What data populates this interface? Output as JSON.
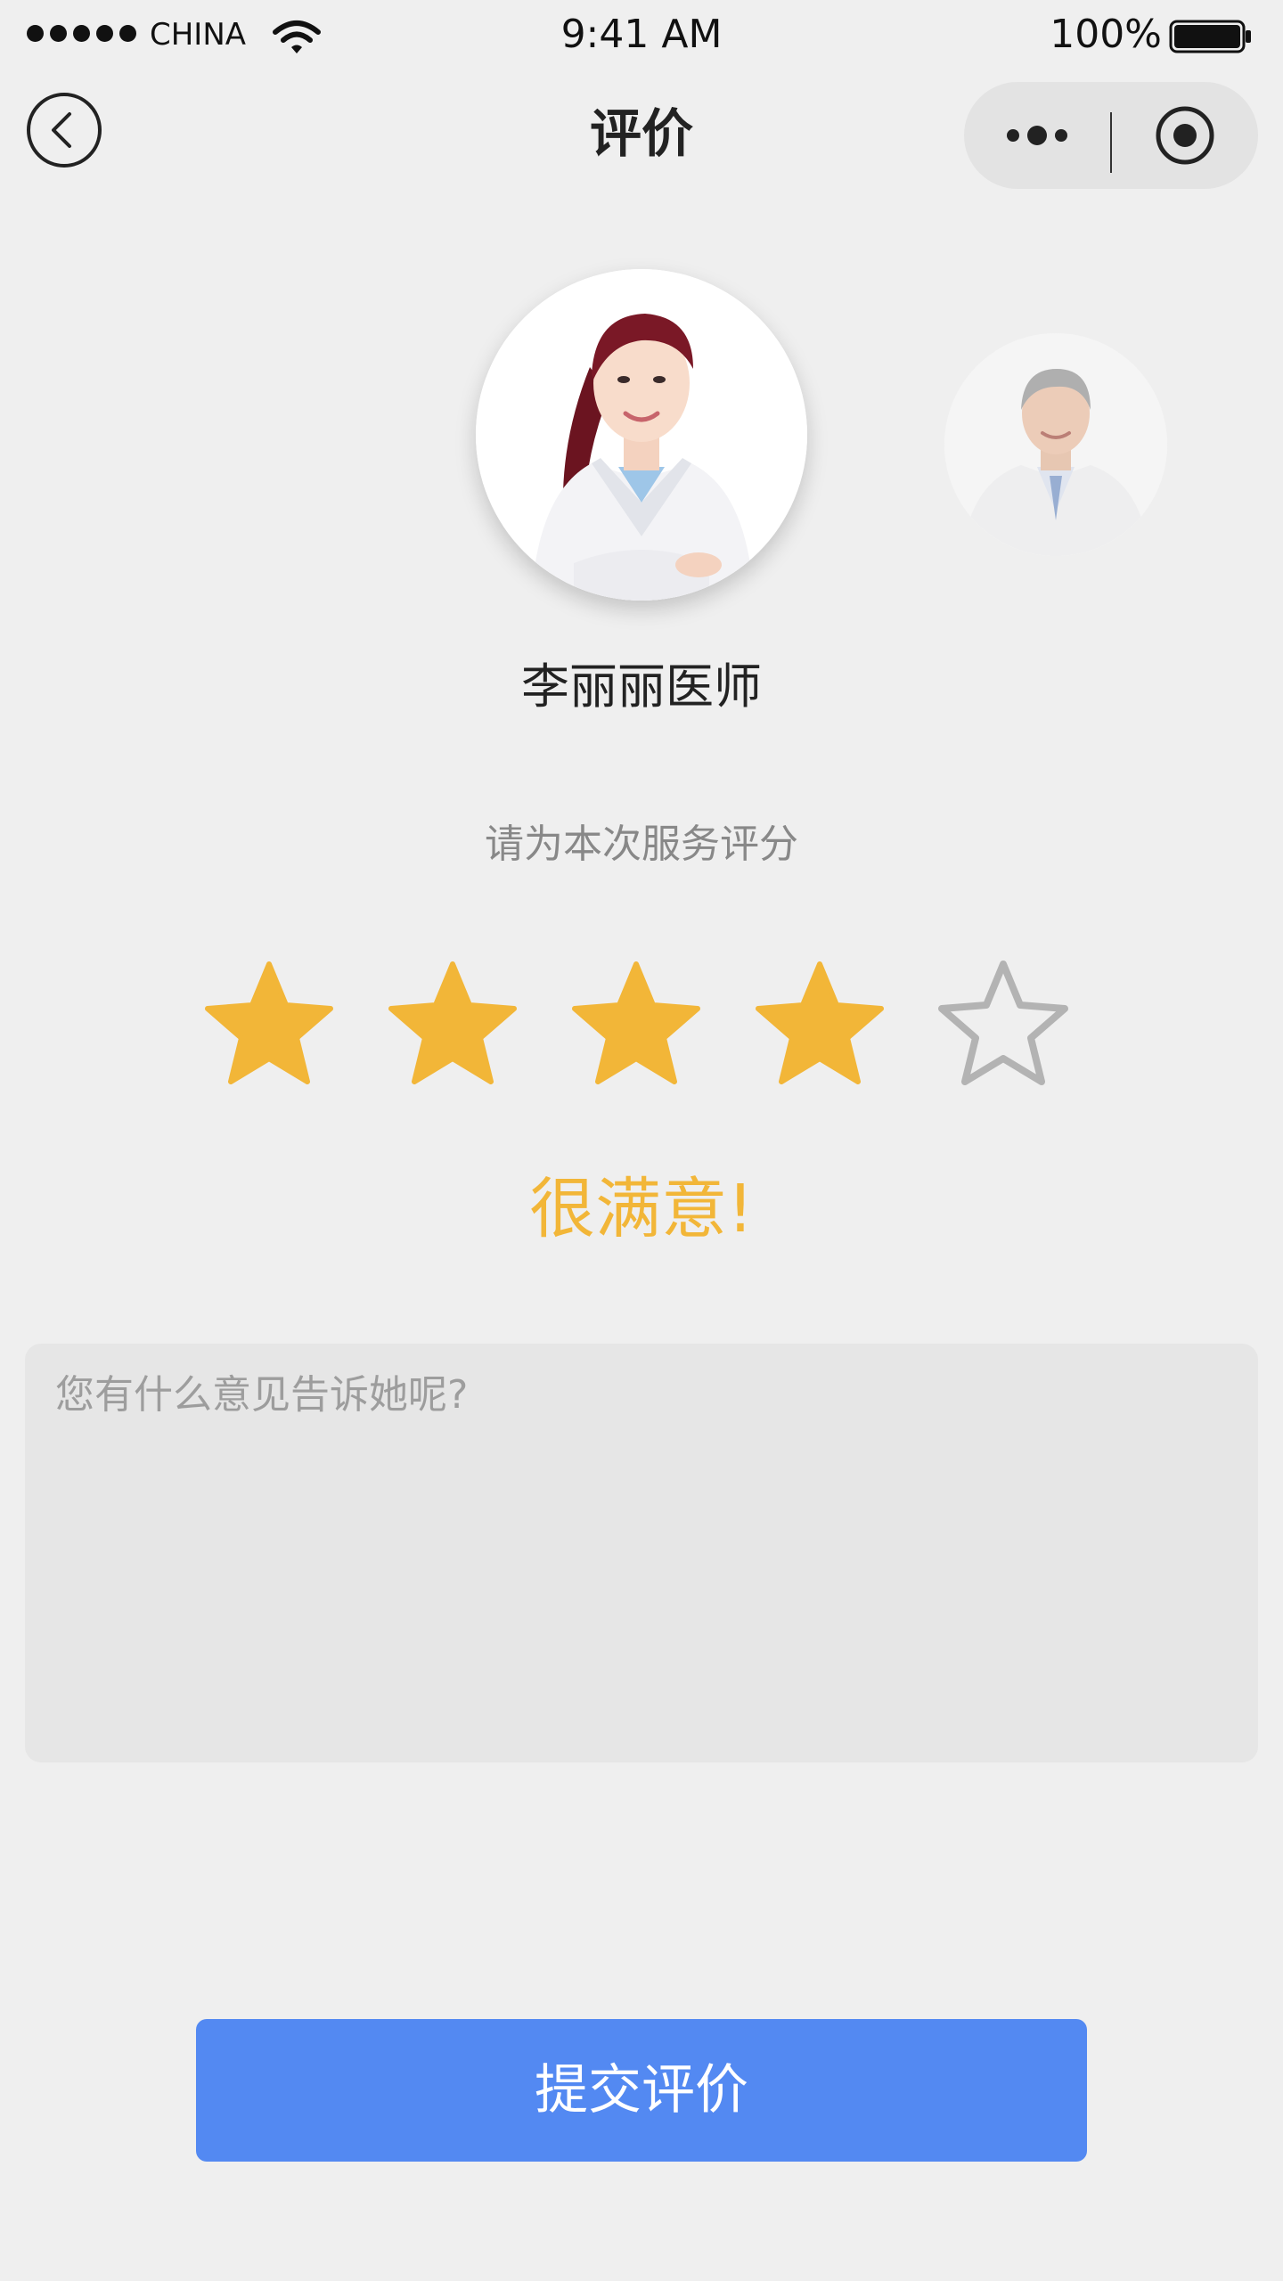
{
  "status_bar": {
    "carrier": "CHINA",
    "time": "9:41 AM",
    "battery": "100%",
    "signal_icon": "signal-dots-icon",
    "wifi_icon": "wifi-icon",
    "battery_icon": "battery-full-icon"
  },
  "nav": {
    "title": "评价",
    "back_icon": "back-arrow-icon",
    "more_icon": "more-dots-icon",
    "close_icon": "record-circle-icon"
  },
  "doctors": [
    {
      "name": "李丽丽医师",
      "selected": true
    },
    {
      "selected": false
    }
  ],
  "rating": {
    "prompt": "请为本次服务评分",
    "value": 4,
    "max": 5,
    "label": "很满意!",
    "filled_color": "#f2b638",
    "empty_color": "#b3b3b3"
  },
  "comment": {
    "placeholder": "您有什么意见告诉她呢?",
    "value": ""
  },
  "submit": {
    "label": "提交评价",
    "color": "#5389f2"
  }
}
